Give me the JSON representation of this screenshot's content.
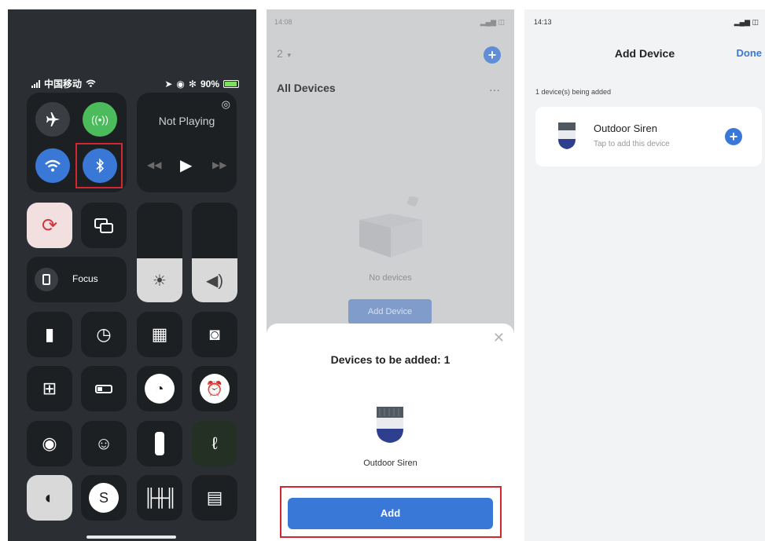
{
  "panel1": {
    "status": {
      "carrier": "中国移动",
      "battery": "90%"
    },
    "now_playing": "Not Playing",
    "focus_label": "Focus",
    "colors": {
      "background": "#2b2f33",
      "tile": "#1d2023",
      "cellular_green": "#4cbb5c",
      "blue": "#3a78d8",
      "highlight_red": "#d22630"
    }
  },
  "panel2": {
    "status_time": "14:08",
    "selector": "2",
    "title": "All Devices",
    "more": "···",
    "empty_text": "No devices",
    "add_device_button": "Add Device",
    "sheet": {
      "heading": "Devices to be added: 1",
      "device_name": "Outdoor Siren",
      "add_button": "Add"
    }
  },
  "panel3": {
    "status_time": "14:13",
    "title": "Add Device",
    "done": "Done",
    "subtitle": "1 device(s) being added",
    "device": {
      "name": "Outdoor Siren",
      "hint": "Tap to add this device"
    }
  }
}
